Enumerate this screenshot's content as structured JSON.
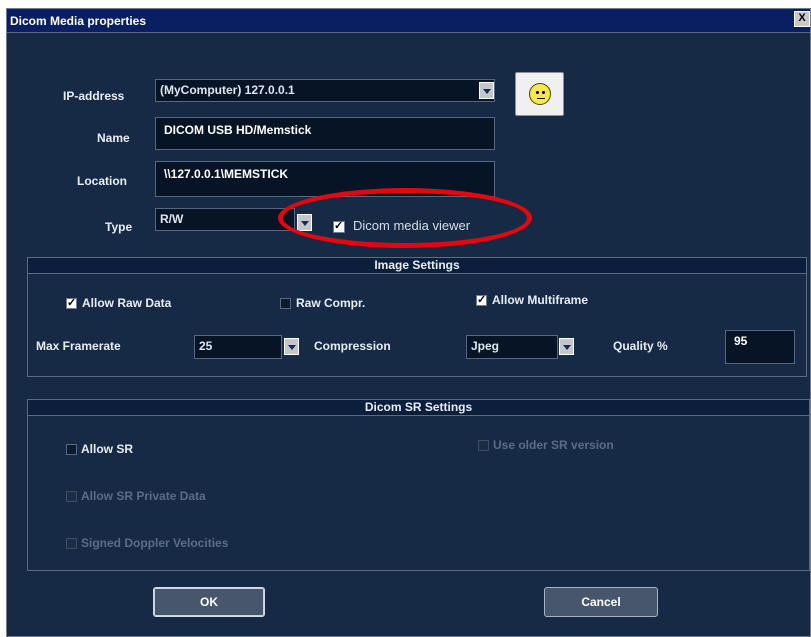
{
  "window": {
    "title": "Dicom Media properties",
    "close_glyph": "X"
  },
  "ip_address": {
    "label": "IP-address",
    "value": "(MyComputer) 127.0.0.1"
  },
  "name": {
    "label": "Name",
    "value": "DICOM USB HD/Memstick"
  },
  "location": {
    "label": "Location",
    "value": "\\\\127.0.0.1\\MEMSTICK"
  },
  "type": {
    "label": "Type",
    "value": "R/W"
  },
  "dicom_media_viewer": {
    "label": "Dicom media viewer",
    "checked": true
  },
  "status_icon": "smiley-face-icon",
  "image_settings": {
    "title": "Image Settings",
    "allow_raw_data": {
      "label": "Allow Raw Data",
      "checked": true
    },
    "raw_compr": {
      "label": "Raw Compr.",
      "checked": false
    },
    "allow_multiframe": {
      "label": "Allow Multiframe",
      "checked": true
    },
    "max_framerate": {
      "label": "Max Framerate",
      "value": "25"
    },
    "compression": {
      "label": "Compression",
      "value": "Jpeg"
    },
    "quality": {
      "label": "Quality %",
      "value": "95"
    }
  },
  "sr_settings": {
    "title": "Dicom SR Settings",
    "allow_sr": {
      "label": "Allow SR",
      "checked": false,
      "enabled": true
    },
    "use_older_sr": {
      "label": "Use older SR version",
      "checked": false,
      "enabled": false
    },
    "allow_sr_private": {
      "label": "Allow SR Private Data",
      "checked": false,
      "enabled": false
    },
    "signed_doppler": {
      "label": "Signed Doppler Velocities",
      "checked": false,
      "enabled": false
    }
  },
  "buttons": {
    "ok": "OK",
    "cancel": "Cancel"
  },
  "colors": {
    "background": "#162a45",
    "titlebar": "#0a1f62",
    "highlight": "#e4070d",
    "smiley": "#f6e84a"
  }
}
